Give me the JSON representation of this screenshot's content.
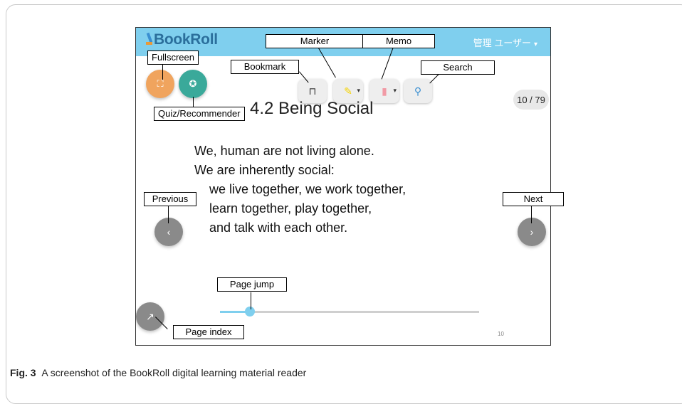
{
  "app": {
    "logo_text": "BookRoll",
    "user_menu_label": "管理 ユーザー",
    "page_counter": "10 / 79",
    "footer_page_number": "10"
  },
  "slide": {
    "title": "4.2 Being Social",
    "lines": [
      "We, human are not living alone.",
      "We are inherently social:",
      "we live together, we work together,",
      "learn together, play together,",
      "and talk with each other."
    ]
  },
  "slider": {
    "current_page": 10,
    "total_pages": 79
  },
  "icons": {
    "fullscreen": "⛶",
    "quiz": "✪",
    "bookmark": "⊓",
    "marker": "✎",
    "memo": "▮",
    "search": "⚲",
    "previous": "‹",
    "next": "›",
    "page_index": "↗",
    "caret": "▾"
  },
  "callouts": {
    "fullscreen": "Fullscreen",
    "marker": "Marker",
    "memo": "Memo",
    "bookmark": "Bookmark",
    "search": "Search",
    "quiz": "Quiz/Recommender",
    "previous": "Previous",
    "next": "Next",
    "page_jump": "Page jump",
    "page_index": "Page index"
  },
  "caption": {
    "label": "Fig. 3",
    "text": "A screenshot of the BookRoll digital learning material reader"
  },
  "colors": {
    "header": "#7fcfee",
    "fullscreen_button": "#f0a45e",
    "quiz_button": "#3aa99a",
    "nav_button": "#8a8a8a",
    "marker_icon": "#f5d300",
    "memo_icon": "#f19aa5"
  }
}
